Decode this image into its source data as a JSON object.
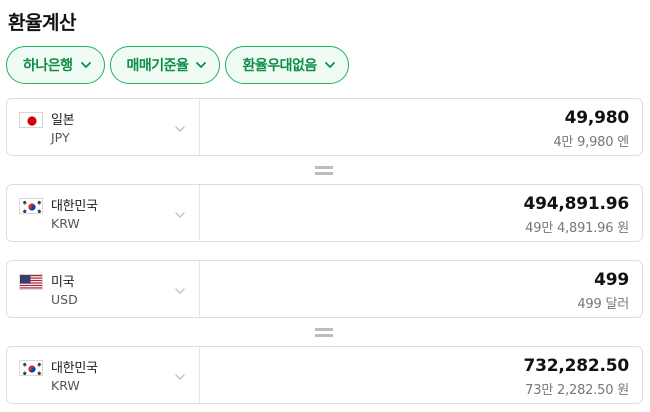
{
  "title": "환율계산",
  "filters": [
    {
      "label": "하나은행"
    },
    {
      "label": "매매기준율"
    },
    {
      "label": "환율우대없음"
    }
  ],
  "colors": {
    "accent": "#0a8f44",
    "pill_border": "#21b35f"
  },
  "converters": [
    {
      "top": {
        "flag": "japan-flag",
        "name": "일본",
        "code": "JPY",
        "amount": "49,980",
        "words": "4만 9,980 엔"
      },
      "bottom": {
        "flag": "korea-flag",
        "name": "대한민국",
        "code": "KRW",
        "amount": "494,891.96",
        "words": "49만 4,891.96 원"
      }
    },
    {
      "top": {
        "flag": "usa-flag",
        "name": "미국",
        "code": "USD",
        "amount": "499",
        "words": "499 달러"
      },
      "bottom": {
        "flag": "korea-flag",
        "name": "대한민국",
        "code": "KRW",
        "amount": "732,282.50",
        "words": "73만 2,282.50 원"
      }
    }
  ]
}
